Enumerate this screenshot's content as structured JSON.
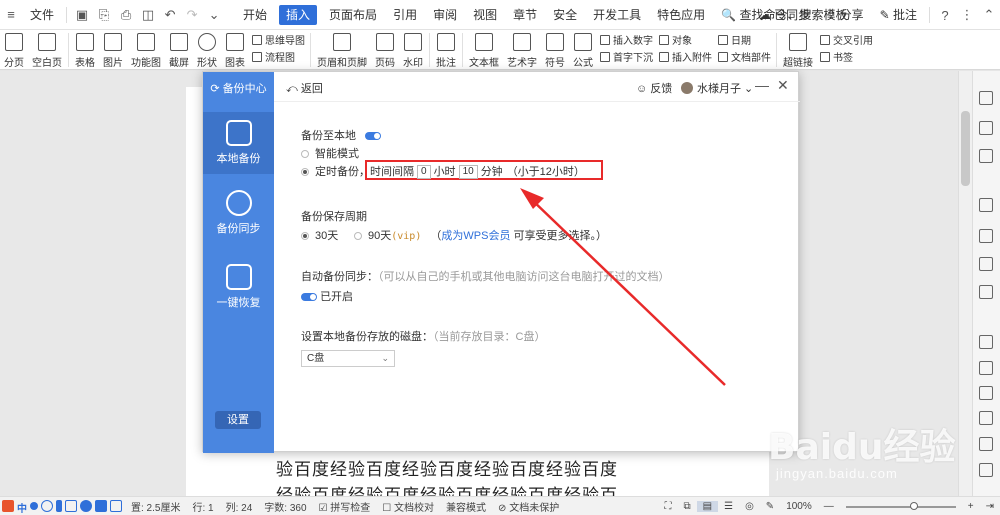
{
  "menubar": {
    "file": "文件",
    "tabs": [
      "开始",
      "插入",
      "页面布局",
      "引用",
      "审阅",
      "视图",
      "章节",
      "安全",
      "开发工具",
      "特色应用"
    ],
    "active_tab": "插入",
    "search": "查找命令、搜索模板",
    "sync": "已同步",
    "share": "分享",
    "comment": "批注"
  },
  "ribbon": {
    "large": [
      {
        "label": "分页",
        "icon": "page-break-icon"
      },
      {
        "label": "空白页",
        "icon": "blank-page-icon"
      },
      {
        "label": "表格",
        "icon": "table-icon"
      },
      {
        "label": "图片",
        "icon": "picture-icon"
      },
      {
        "label": "功能图",
        "icon": "function-chart-icon"
      },
      {
        "label": "截屏",
        "icon": "screenshot-icon"
      },
      {
        "label": "形状",
        "icon": "shape-icon"
      },
      {
        "label": "图表",
        "icon": "chart-icon"
      }
    ],
    "small1": [
      "思维导图",
      "流程图"
    ],
    "large2": [
      {
        "label": "页眉和页脚",
        "icon": "header-footer-icon"
      },
      {
        "label": "页码",
        "icon": "page-number-icon"
      },
      {
        "label": "水印",
        "icon": "watermark-icon"
      },
      {
        "label": "批注",
        "icon": "comment-icon"
      },
      {
        "label": "文本框",
        "icon": "textbox-icon"
      },
      {
        "label": "艺术字",
        "icon": "wordart-icon"
      },
      {
        "label": "符号",
        "icon": "symbol-icon"
      },
      {
        "label": "公式",
        "icon": "formula-icon"
      }
    ],
    "small2": [
      "插入数字",
      "首字下沉"
    ],
    "small3": [
      "对象",
      "插入附件"
    ],
    "small4": [
      "日期",
      "文档部件"
    ],
    "large3": [
      {
        "label": "超链接",
        "icon": "hyperlink-icon"
      }
    ],
    "small5": [
      "交叉引用",
      "书签"
    ]
  },
  "dialog": {
    "brand": "备份中心",
    "nav": [
      "本地备份",
      "备份同步",
      "一键恢复"
    ],
    "settings": "设置",
    "back": "返回",
    "feedback": "反馈",
    "user": "水様月子",
    "backup_local": "备份至本地",
    "smart_mode": "智能模式",
    "timed_prefix": "定时备份，时间间隔",
    "hours_value": "0",
    "hours_unit": "小时",
    "minutes_value": "10",
    "minutes_unit": "分钟",
    "timed_note": "（小于12小时）",
    "period_title": "备份保存周期",
    "period_30": "30天",
    "period_90": "90天",
    "vip": "(vip)",
    "vip_link": "成为WPS会员",
    "vip_suffix": "可享受更多选择。）",
    "vip_prefix": "（",
    "auto_sync_title": "自动备份同步：",
    "auto_sync_note": "（可以从自己的手机或其他电脑访问这台电脑打开过的文档）",
    "auto_sync_on": "已开启",
    "disk_title": "设置本地备份存放的磁盘：",
    "disk_current": "（当前存放目录：C盘）",
    "disk_value": "C盘"
  },
  "document": {
    "line1": "验百度经验百度经验百度经验百度经验百度",
    "line2": "经验百度经验百度经验百度经验百度经验百"
  },
  "watermark": {
    "brand": "Baidu经验",
    "url": "jingyan.baidu.com"
  },
  "status": {
    "ime": "中",
    "margin": "置: 2.5厘米",
    "row": "行: 1",
    "col": "列: 24",
    "words": "字数: 360",
    "spell": "拼写检查",
    "proof": "文档校对",
    "compat": "兼容模式",
    "protect": "文档未保护",
    "zoom": "100%",
    "zoom_fraction": 0.62
  },
  "colors": {
    "accent": "#2f6fd9",
    "sidebar": "#4a86e0",
    "highlight": "#e82a2a"
  }
}
